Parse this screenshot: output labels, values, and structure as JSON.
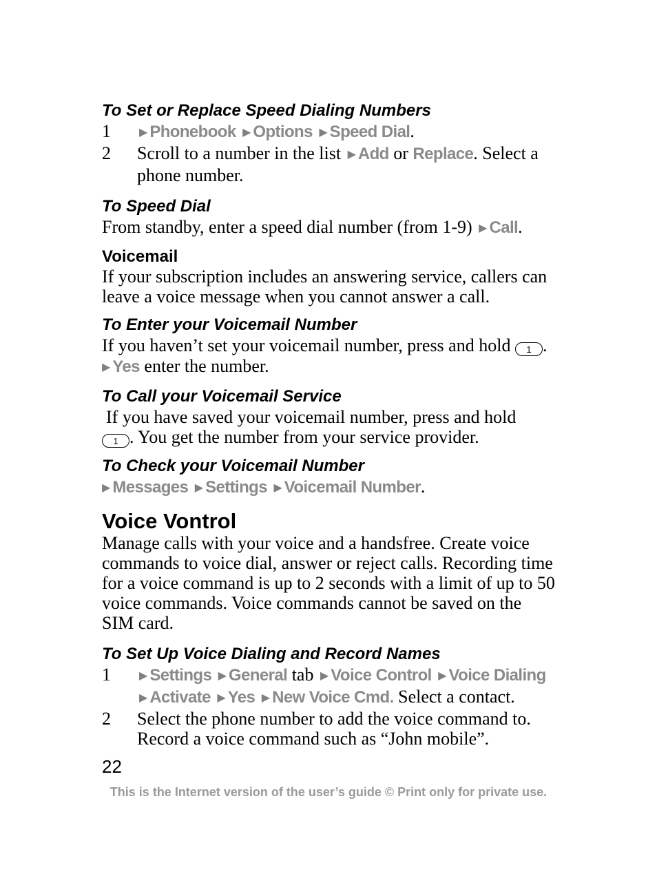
{
  "sections": {
    "speed_set": {
      "heading": "To Set or Replace Speed Dialing Numbers",
      "step1": {
        "num": "1",
        "menu": [
          "Phonebook",
          "Options",
          "Speed Dial"
        ],
        "tail": "."
      },
      "step2": {
        "num": "2",
        "pre": "Scroll to a number in the list",
        "menu1": "Add",
        "mid": " or ",
        "menu2": "Replace",
        "post": ". Select a phone number."
      }
    },
    "speed_dial": {
      "heading": "To Speed Dial",
      "pre": "From standby, enter a speed dial number (from 1-9)",
      "menu": "Call",
      "tail": "."
    },
    "voicemail": {
      "heading": "Voicemail",
      "body": "If your subscription includes an answering service, callers can leave a voice message when you cannot answer a call."
    },
    "enter_vm": {
      "heading": "To Enter your Voicemail Number",
      "pre": "If you haven’t set your voicemail number, press and hold",
      "key": "1",
      "tail": ".",
      "menu": "Yes",
      "post": " enter the number."
    },
    "call_vm": {
      "heading": "To Call your Voicemail Service",
      "pre": "If you have saved your voicemail number, press and hold",
      "key": "1",
      "post": ". You get the number from your service provider."
    },
    "check_vm": {
      "heading": "To Check your Voicemail Number",
      "menu": [
        "Messages",
        "Settings",
        "Voicemail Number"
      ],
      "tail": "."
    },
    "voice_control": {
      "heading": "Voice Vontrol",
      "body": "Manage calls with your voice and a handsfree. Create voice commands to voice dial, answer or reject calls. Recording time for a voice command is up to 2 seconds with a limit of up to 50 voice commands. Voice commands cannot be saved on the SIM card."
    },
    "setup_vd": {
      "heading": "To Set Up Voice Dialing and Record Names",
      "step1": {
        "num": "1",
        "m1": "Settings",
        "m2": "General",
        "tab": " tab",
        "m3": "Voice Control",
        "m4": "Voice Dialing",
        "m5": "Activate",
        "m6": "Yes",
        "m7": "New Voice Cmd.",
        "post": " Select a contact."
      },
      "step2": {
        "num": "2",
        "text": "Select the phone number to add the voice command to. Record a voice command such as “John mobile”."
      }
    }
  },
  "page_number": "22",
  "footer": "This is the Internet version of the user’s guide © Print only for private use.",
  "icons": {
    "arrow": "▶"
  }
}
